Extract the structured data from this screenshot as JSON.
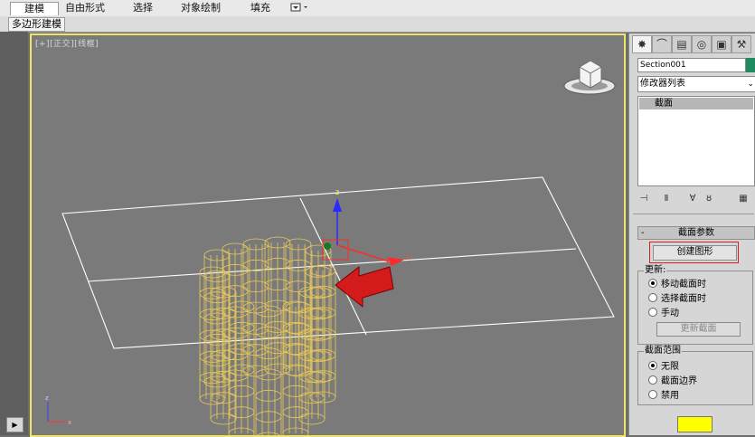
{
  "ribbon": {
    "tabs": [
      {
        "label": "建模",
        "active": true
      },
      {
        "label": "自由形式",
        "active": false
      },
      {
        "label": "选择",
        "active": false
      },
      {
        "label": "对象绘制",
        "active": false
      },
      {
        "label": "填充",
        "active": false
      }
    ],
    "more_icon": "ribbon-options-icon",
    "subtab_label": "多边形建模"
  },
  "viewport": {
    "label": "[+][正交][线框]",
    "border_color": "#f0e36a",
    "geometry_color": "#e8c85a",
    "axis_labels": {
      "x": "x",
      "y": "y",
      "z": "z"
    }
  },
  "command_panel": {
    "tabs": [
      "create-icon",
      "modify-icon",
      "hierarchy-icon",
      "motion-icon",
      "display-icon",
      "utilities-icon"
    ],
    "object_name": "Section001",
    "object_color": "#1f8a5f",
    "modifier_list_label": "修改器列表",
    "stack_items": [
      "截面"
    ],
    "rollout_title": "截面参数",
    "create_shape_button": "创建图形",
    "update_group": {
      "title": "更新:",
      "options": [
        "移动截面时",
        "选择截面时",
        "手动"
      ],
      "selected": 0,
      "update_button": "更新截面"
    },
    "extents_group": {
      "title": "截面范围",
      "options": [
        "无限",
        "截面边界",
        "禁用"
      ],
      "selected": 0
    },
    "section_color": "#ffff00"
  }
}
